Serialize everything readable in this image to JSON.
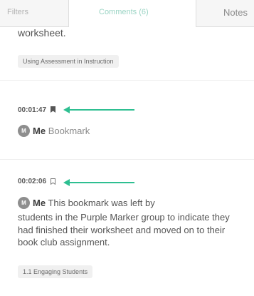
{
  "tabs": {
    "filters": "Filters",
    "comments": "Comments (6)",
    "notes": "Notes"
  },
  "previous": {
    "text_tail": "worksheet.",
    "tag": "Using Assessment in Instruction"
  },
  "comments": [
    {
      "timestamp": "00:01:47",
      "bookmark_state": "filled",
      "avatar_initial": "M",
      "author": "Me",
      "text": "Bookmark"
    },
    {
      "timestamp": "00:02:06",
      "bookmark_state": "outline",
      "avatar_initial": "M",
      "author": "Me",
      "text_first_line": "This bookmark was left by",
      "text_rest": "students in the Purple Marker group to indicate they had finished their worksheet and moved on to their book club assignment.",
      "tag": "1.1 Engaging Students"
    }
  ],
  "colors": {
    "accent_arrow": "#2ebf91",
    "avatar": "#8e8e8e",
    "active_tab_text": "#9bd4c4"
  }
}
